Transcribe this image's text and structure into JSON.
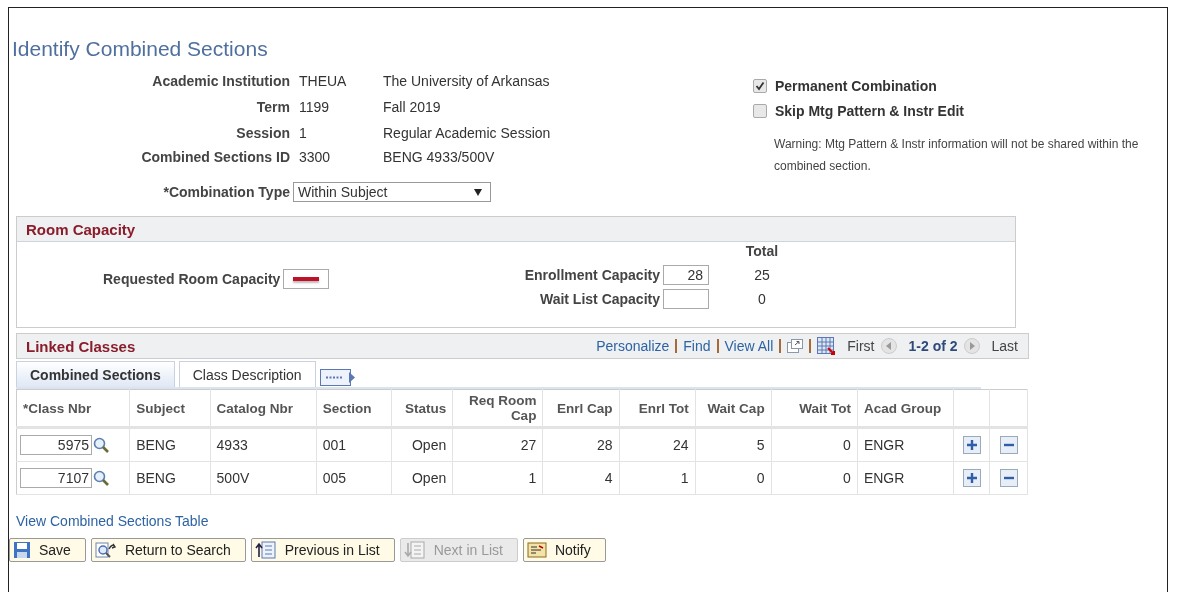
{
  "title": "Identify Combined Sections",
  "fields": [
    {
      "label": "Academic Institution",
      "value": "THEUA",
      "description": "The University of Arkansas"
    },
    {
      "label": "Term",
      "value": "1199",
      "description": "Fall 2019"
    },
    {
      "label": "Session",
      "value": "1",
      "description": "Regular Academic Session"
    },
    {
      "label": "Combined Sections ID",
      "value": "3300",
      "description": "BENG 4933/500V"
    }
  ],
  "combination_type": {
    "label": "*Combination Type",
    "value": "Within Subject"
  },
  "options": [
    {
      "label": "Permanent Combination",
      "checked": true
    },
    {
      "label": "Skip Mtg Pattern & Instr Edit",
      "checked": false
    }
  ],
  "warning": "Warning: Mtg Pattern & Instr information will not be shared within the combined section.",
  "room_capacity": {
    "title": "Room Capacity",
    "requested_label": "Requested Room Capacity",
    "total_heading": "Total",
    "enrollment_label": "Enrollment Capacity",
    "enrollment_value": "28",
    "enrollment_total": "25",
    "waitlist_label": "Wait List Capacity",
    "waitlist_total": "0"
  },
  "linked_classes": {
    "title": "Linked Classes",
    "nav_links": [
      "Personalize",
      "Find",
      "View All"
    ],
    "pager": {
      "first": "First",
      "range": "1-2 of 2",
      "last": "Last"
    },
    "tabs": [
      {
        "label": "Combined Sections",
        "selected": true
      },
      {
        "label": "Class Description",
        "selected": false
      }
    ],
    "columns": [
      "*Class Nbr",
      "Subject",
      "Catalog Nbr",
      "Section",
      "Status",
      "Req Room Cap",
      "Enrl Cap",
      "Enrl Tot",
      "Wait Cap",
      "Wait Tot",
      "Acad Group"
    ],
    "rows": [
      {
        "cells": [
          "5975",
          "BENG",
          "4933",
          "001",
          "Open",
          "27",
          "28",
          "24",
          "5",
          "0",
          "ENGR"
        ]
      },
      {
        "cells": [
          "7107",
          "BENG",
          "500V",
          "005",
          "Open",
          "1",
          "4",
          "1",
          "0",
          "0",
          "ENGR"
        ]
      }
    ]
  },
  "link": "View Combined Sections Table",
  "buttons": [
    {
      "kind": "save",
      "label": "Save",
      "disabled": false
    },
    {
      "kind": "search",
      "label": "Return to Search",
      "disabled": false
    },
    {
      "kind": "previous",
      "label": "Previous in List",
      "disabled": false
    },
    {
      "kind": "next",
      "label": "Next in List",
      "disabled": true
    },
    {
      "kind": "notify",
      "label": "Notify",
      "disabled": false
    }
  ]
}
